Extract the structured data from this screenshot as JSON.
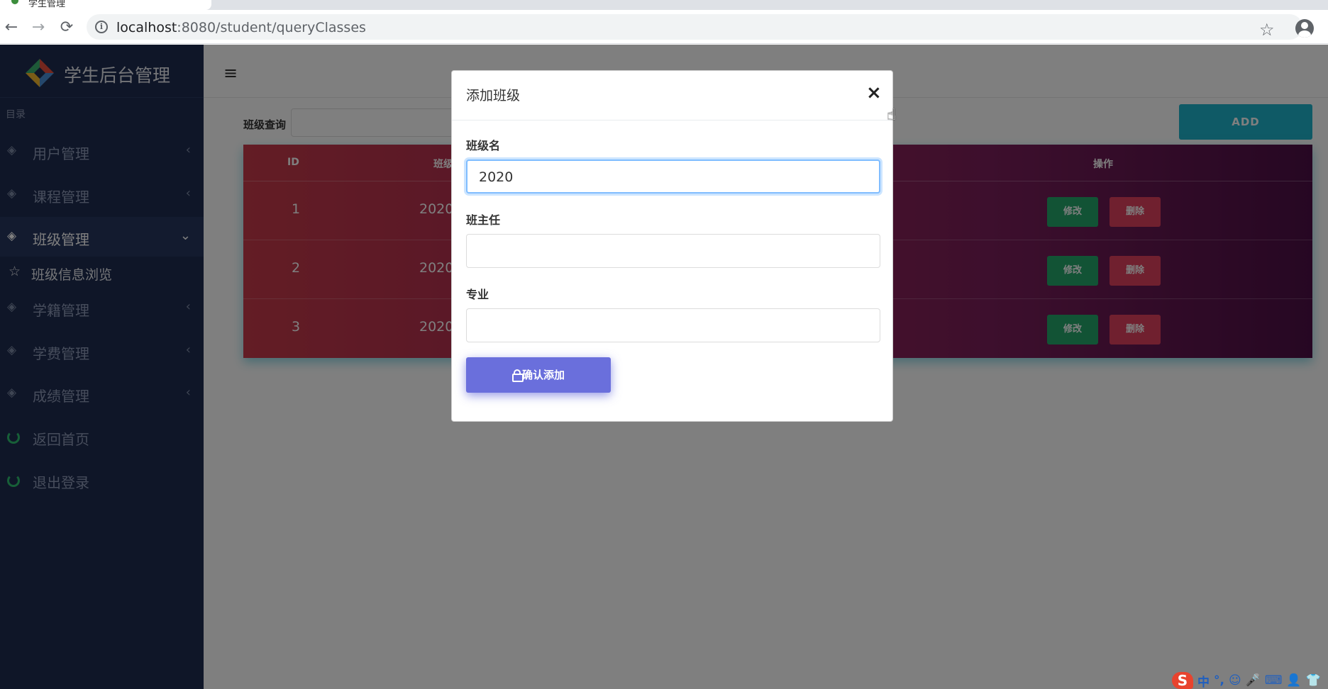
{
  "browser": {
    "tab_title": "学生管理",
    "url_host": "localhost",
    "url_rest": ":8080/student/queryClasses",
    "back_icon": "←",
    "forward_icon": "→",
    "reload_icon": "⟳",
    "info_icon": "i",
    "star_icon": "☆"
  },
  "sidebar": {
    "brand": "学生后台管理",
    "caption": "目录",
    "items": [
      {
        "label": "用户管理",
        "arrow": "‹"
      },
      {
        "label": "课程管理",
        "arrow": "‹"
      },
      {
        "label": "班级管理",
        "arrow": "⌄"
      },
      {
        "label": "学籍管理",
        "arrow": "‹"
      },
      {
        "label": "学费管理",
        "arrow": "‹"
      },
      {
        "label": "成绩管理",
        "arrow": "‹"
      },
      {
        "label": "返回首页"
      },
      {
        "label": "退出登录"
      }
    ],
    "sub_item": {
      "label": "班级信息浏览",
      "icon": "☆"
    },
    "layer_icon": "◈"
  },
  "topbar": {
    "menu_icon": "≡"
  },
  "main": {
    "search_label": "班级查询",
    "add_label": "ADD",
    "columns": {
      "id": "ID",
      "name": "班级",
      "ops": "操作"
    },
    "rows": [
      {
        "id": "1",
        "name": "2020",
        "edit": "修改",
        "delete": "删除"
      },
      {
        "id": "2",
        "name": "2020",
        "edit": "修改",
        "delete": "删除"
      },
      {
        "id": "3",
        "name": "2020",
        "edit": "修改",
        "delete": "删除"
      }
    ]
  },
  "modal": {
    "title": "添加班级",
    "close": "×",
    "fields": [
      {
        "label": "班级名",
        "value": "2020"
      },
      {
        "label": "班主任",
        "value": ""
      },
      {
        "label": "专业",
        "value": ""
      }
    ],
    "confirm": "确认添加"
  },
  "cursor_icon": "☝",
  "ime": {
    "logo": "S",
    "items": [
      "中",
      "°,",
      "☺",
      "🎤",
      "⌨",
      "👤",
      "👕"
    ]
  }
}
